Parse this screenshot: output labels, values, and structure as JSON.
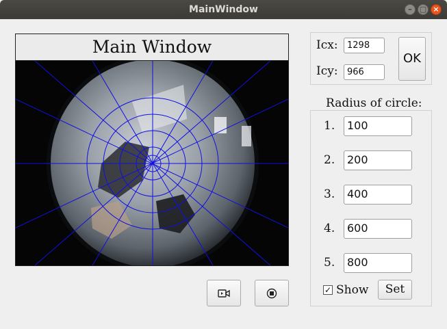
{
  "window": {
    "title": "MainWindow"
  },
  "frame": {
    "title": "Main Window"
  },
  "center": {
    "icx_label": "Icx:",
    "icx_value": "1298",
    "icy_label": "Icy:",
    "icy_value": "966",
    "ok_label": "OK"
  },
  "radius": {
    "heading": "Radius of circle:",
    "items": [
      {
        "num": "1.",
        "value": "100"
      },
      {
        "num": "2.",
        "value": "200"
      },
      {
        "num": "3.",
        "value": "400"
      },
      {
        "num": "4.",
        "value": "600"
      },
      {
        "num": "5.",
        "value": "800"
      }
    ],
    "show_label": "Show",
    "show_checked": true,
    "set_label": "Set"
  },
  "toolbar": {
    "record_icon": "video-camera-icon",
    "stop_icon": "stop-icon"
  },
  "colors": {
    "overlay": "#1010e0",
    "titlebar": "#3c3b37",
    "close": "#e9541f"
  }
}
